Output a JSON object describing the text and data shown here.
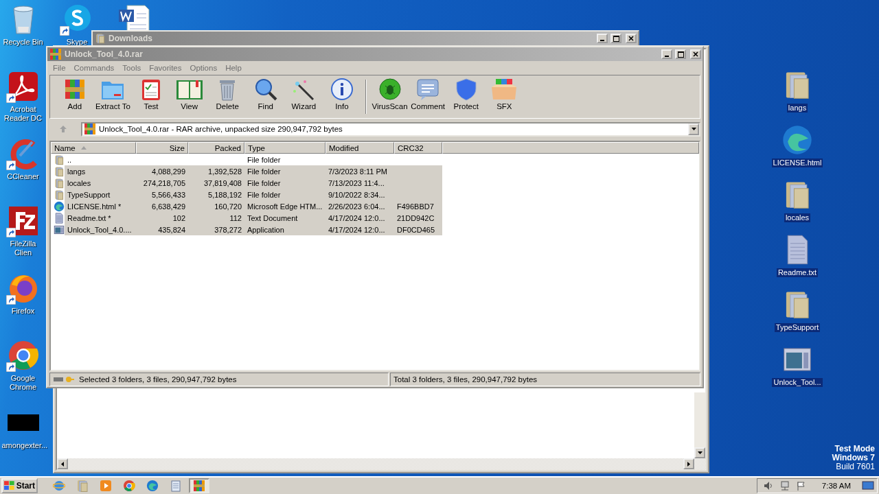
{
  "desktop": {
    "left_icons": [
      {
        "label": "Recycle Bin",
        "kind": "recycle",
        "shortcut": false
      },
      {
        "label": "Acrobat Reader DC",
        "kind": "acrobat",
        "shortcut": true
      },
      {
        "label": "CCleaner",
        "kind": "ccleaner",
        "shortcut": true
      },
      {
        "label": "FileZilla Clien",
        "kind": "filezilla",
        "shortcut": true
      },
      {
        "label": "Firefox",
        "kind": "firefox",
        "shortcut": true
      },
      {
        "label": "Google Chrome",
        "kind": "chrome",
        "shortcut": true
      },
      {
        "label": "amongexter...",
        "kind": "black",
        "shortcut": false
      },
      {
        "label": "Skype",
        "kind": "skype",
        "shortcut": true
      },
      {
        "kind": "word"
      }
    ],
    "right_icons": [
      {
        "label": "langs",
        "kind": "folder",
        "selected": true
      },
      {
        "label": "LICENSE.html",
        "kind": "edge",
        "selected": true
      },
      {
        "label": "locales",
        "kind": "folder",
        "selected": true
      },
      {
        "label": "Readme.txt",
        "kind": "text",
        "selected": true
      },
      {
        "label": "TypeSupport",
        "kind": "folder",
        "selected": true
      },
      {
        "label": "Unlock_Tool...",
        "kind": "app",
        "selected": true
      }
    ],
    "test_mode": [
      "Test Mode",
      "Windows 7",
      "Build 7601"
    ]
  },
  "downloads_window": {
    "title": "Downloads"
  },
  "winrar_window": {
    "title": "Unlock_Tool_4.0.rar",
    "menu": [
      "File",
      "Commands",
      "Tools",
      "Favorites",
      "Options",
      "Help"
    ],
    "toolbar_groups": [
      [
        {
          "label": "Add",
          "kind": "add"
        },
        {
          "label": "Extract To",
          "kind": "extract"
        },
        {
          "label": "Test",
          "kind": "test"
        },
        {
          "label": "View",
          "kind": "view"
        },
        {
          "label": "Delete",
          "kind": "delete"
        },
        {
          "label": "Find",
          "kind": "find"
        },
        {
          "label": "Wizard",
          "kind": "wizard"
        },
        {
          "label": "Info",
          "kind": "info"
        }
      ],
      [
        {
          "label": "VirusScan",
          "kind": "virus"
        },
        {
          "label": "Comment",
          "kind": "comment"
        },
        {
          "label": "Protect",
          "kind": "protect"
        },
        {
          "label": "SFX",
          "kind": "sfx"
        }
      ]
    ],
    "address": "Unlock_Tool_4.0.rar - RAR archive, unpacked size 290,947,792 bytes",
    "columns": [
      {
        "label": "Name",
        "sorted": true
      },
      {
        "label": "Size",
        "sorted": false
      },
      {
        "label": "Packed",
        "sorted": false
      },
      {
        "label": "Type",
        "sorted": false
      },
      {
        "label": "Modified",
        "sorted": false
      },
      {
        "label": "CRC32",
        "sorted": false
      }
    ],
    "rows": [
      {
        "kind": "folder",
        "cells": [
          "..",
          "",
          "",
          "File folder",
          "",
          ""
        ],
        "selected": false
      },
      {
        "kind": "folder",
        "cells": [
          "langs",
          "4,088,299",
          "1,392,528",
          "File folder",
          "7/3/2023 8:11 PM",
          ""
        ],
        "selected": true
      },
      {
        "kind": "folder",
        "cells": [
          "locales",
          "274,218,705",
          "37,819,408",
          "File folder",
          "7/13/2023 11:4...",
          ""
        ],
        "selected": true
      },
      {
        "kind": "folder",
        "cells": [
          "TypeSupport",
          "5,566,433",
          "5,188,192",
          "File folder",
          "9/10/2022 8:34...",
          ""
        ],
        "selected": true
      },
      {
        "kind": "edge",
        "cells": [
          "LICENSE.html *",
          "6,638,429",
          "160,720",
          "Microsoft Edge HTM...",
          "2/26/2023 6:04...",
          "F496BBD7"
        ],
        "selected": true
      },
      {
        "kind": "text",
        "cells": [
          "Readme.txt *",
          "102",
          "112",
          "Text Document",
          "4/17/2024 12:0...",
          "21DD942C"
        ],
        "selected": true
      },
      {
        "kind": "app",
        "cells": [
          "Unlock_Tool_4.0....",
          "435,824",
          "378,272",
          "Application",
          "4/17/2024 12:0...",
          "DF0CD465"
        ],
        "selected": true
      }
    ],
    "status_left": "Selected 3 folders, 3 files, 290,947,792 bytes",
    "status_right": "Total 3 folders, 3 files, 290,947,792 bytes"
  },
  "taskbar": {
    "start": "Start",
    "items": [
      {
        "kind": "ie",
        "selected": false
      },
      {
        "kind": "explorer",
        "selected": false
      },
      {
        "kind": "media",
        "selected": false
      },
      {
        "kind": "chrome",
        "selected": false
      },
      {
        "kind": "edge",
        "selected": false
      },
      {
        "kind": "notepad",
        "selected": false
      },
      {
        "kind": "winrar",
        "selected": true
      }
    ],
    "time": "7:38 AM"
  }
}
